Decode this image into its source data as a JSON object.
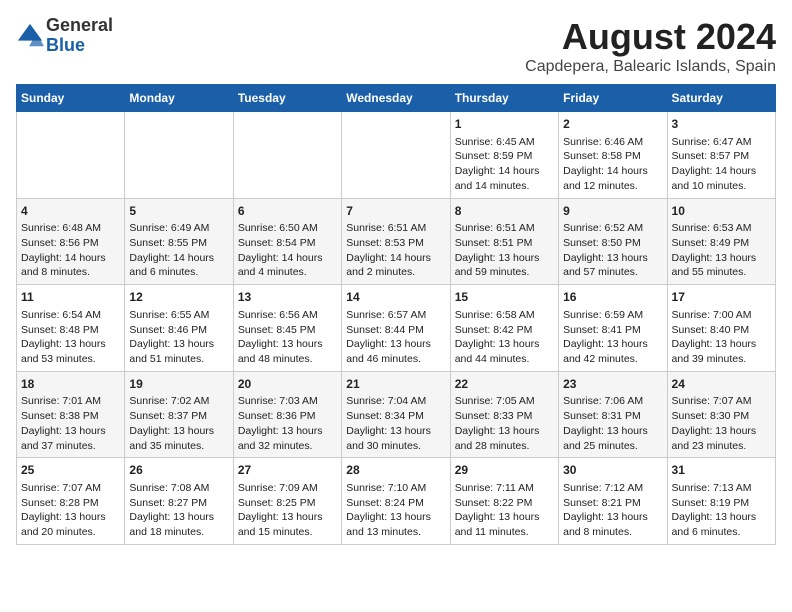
{
  "logo": {
    "general": "General",
    "blue": "Blue"
  },
  "title": "August 2024",
  "subtitle": "Capdepera, Balearic Islands, Spain",
  "weekdays": [
    "Sunday",
    "Monday",
    "Tuesday",
    "Wednesday",
    "Thursday",
    "Friday",
    "Saturday"
  ],
  "weeks": [
    [
      {
        "day": "",
        "content": ""
      },
      {
        "day": "",
        "content": ""
      },
      {
        "day": "",
        "content": ""
      },
      {
        "day": "",
        "content": ""
      },
      {
        "day": "1",
        "content": "Sunrise: 6:45 AM\nSunset: 8:59 PM\nDaylight: 14 hours and 14 minutes."
      },
      {
        "day": "2",
        "content": "Sunrise: 6:46 AM\nSunset: 8:58 PM\nDaylight: 14 hours and 12 minutes."
      },
      {
        "day": "3",
        "content": "Sunrise: 6:47 AM\nSunset: 8:57 PM\nDaylight: 14 hours and 10 minutes."
      }
    ],
    [
      {
        "day": "4",
        "content": "Sunrise: 6:48 AM\nSunset: 8:56 PM\nDaylight: 14 hours and 8 minutes."
      },
      {
        "day": "5",
        "content": "Sunrise: 6:49 AM\nSunset: 8:55 PM\nDaylight: 14 hours and 6 minutes."
      },
      {
        "day": "6",
        "content": "Sunrise: 6:50 AM\nSunset: 8:54 PM\nDaylight: 14 hours and 4 minutes."
      },
      {
        "day": "7",
        "content": "Sunrise: 6:51 AM\nSunset: 8:53 PM\nDaylight: 14 hours and 2 minutes."
      },
      {
        "day": "8",
        "content": "Sunrise: 6:51 AM\nSunset: 8:51 PM\nDaylight: 13 hours and 59 minutes."
      },
      {
        "day": "9",
        "content": "Sunrise: 6:52 AM\nSunset: 8:50 PM\nDaylight: 13 hours and 57 minutes."
      },
      {
        "day": "10",
        "content": "Sunrise: 6:53 AM\nSunset: 8:49 PM\nDaylight: 13 hours and 55 minutes."
      }
    ],
    [
      {
        "day": "11",
        "content": "Sunrise: 6:54 AM\nSunset: 8:48 PM\nDaylight: 13 hours and 53 minutes."
      },
      {
        "day": "12",
        "content": "Sunrise: 6:55 AM\nSunset: 8:46 PM\nDaylight: 13 hours and 51 minutes."
      },
      {
        "day": "13",
        "content": "Sunrise: 6:56 AM\nSunset: 8:45 PM\nDaylight: 13 hours and 48 minutes."
      },
      {
        "day": "14",
        "content": "Sunrise: 6:57 AM\nSunset: 8:44 PM\nDaylight: 13 hours and 46 minutes."
      },
      {
        "day": "15",
        "content": "Sunrise: 6:58 AM\nSunset: 8:42 PM\nDaylight: 13 hours and 44 minutes."
      },
      {
        "day": "16",
        "content": "Sunrise: 6:59 AM\nSunset: 8:41 PM\nDaylight: 13 hours and 42 minutes."
      },
      {
        "day": "17",
        "content": "Sunrise: 7:00 AM\nSunset: 8:40 PM\nDaylight: 13 hours and 39 minutes."
      }
    ],
    [
      {
        "day": "18",
        "content": "Sunrise: 7:01 AM\nSunset: 8:38 PM\nDaylight: 13 hours and 37 minutes."
      },
      {
        "day": "19",
        "content": "Sunrise: 7:02 AM\nSunset: 8:37 PM\nDaylight: 13 hours and 35 minutes."
      },
      {
        "day": "20",
        "content": "Sunrise: 7:03 AM\nSunset: 8:36 PM\nDaylight: 13 hours and 32 minutes."
      },
      {
        "day": "21",
        "content": "Sunrise: 7:04 AM\nSunset: 8:34 PM\nDaylight: 13 hours and 30 minutes."
      },
      {
        "day": "22",
        "content": "Sunrise: 7:05 AM\nSunset: 8:33 PM\nDaylight: 13 hours and 28 minutes."
      },
      {
        "day": "23",
        "content": "Sunrise: 7:06 AM\nSunset: 8:31 PM\nDaylight: 13 hours and 25 minutes."
      },
      {
        "day": "24",
        "content": "Sunrise: 7:07 AM\nSunset: 8:30 PM\nDaylight: 13 hours and 23 minutes."
      }
    ],
    [
      {
        "day": "25",
        "content": "Sunrise: 7:07 AM\nSunset: 8:28 PM\nDaylight: 13 hours and 20 minutes."
      },
      {
        "day": "26",
        "content": "Sunrise: 7:08 AM\nSunset: 8:27 PM\nDaylight: 13 hours and 18 minutes."
      },
      {
        "day": "27",
        "content": "Sunrise: 7:09 AM\nSunset: 8:25 PM\nDaylight: 13 hours and 15 minutes."
      },
      {
        "day": "28",
        "content": "Sunrise: 7:10 AM\nSunset: 8:24 PM\nDaylight: 13 hours and 13 minutes."
      },
      {
        "day": "29",
        "content": "Sunrise: 7:11 AM\nSunset: 8:22 PM\nDaylight: 13 hours and 11 minutes."
      },
      {
        "day": "30",
        "content": "Sunrise: 7:12 AM\nSunset: 8:21 PM\nDaylight: 13 hours and 8 minutes."
      },
      {
        "day": "31",
        "content": "Sunrise: 7:13 AM\nSunset: 8:19 PM\nDaylight: 13 hours and 6 minutes."
      }
    ]
  ]
}
